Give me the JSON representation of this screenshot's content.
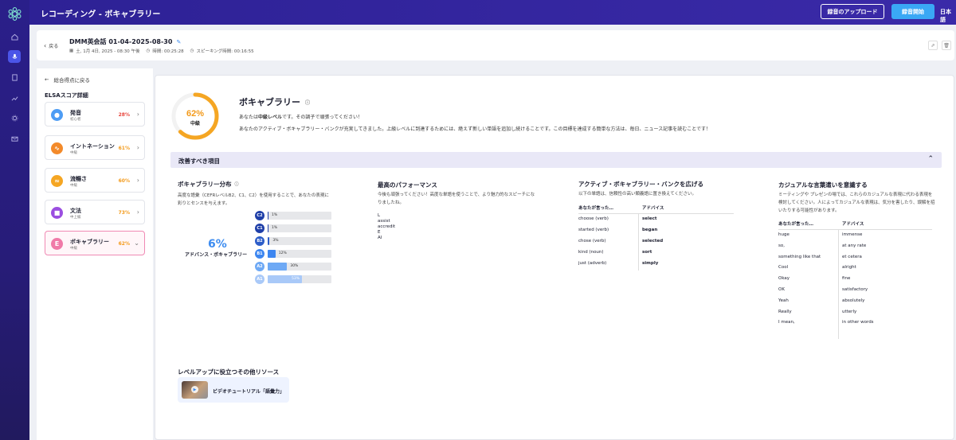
{
  "app": {
    "title": "レコーディング - ボキャブラリー",
    "upload_label": "録音のアップロード",
    "record_label": "録音開始",
    "language": "日本語"
  },
  "recording": {
    "back_label": "戻る",
    "title": "DMM英会話 01-04-2025-08-30",
    "date": "土, 1月 4日, 2025 - 08:30 午後",
    "duration": "時間: 00:25:28",
    "speaking_time": "スピーキング時間: 00:16:55"
  },
  "left": {
    "back_label": "総合得点に戻る",
    "heading": "ELSAスコア詳細",
    "categories": [
      {
        "name": "発音",
        "level": "初心者",
        "percent": "28%",
        "color": "#e8453c",
        "iconColor": "#4d9cf4",
        "icon": "microphone-icon"
      },
      {
        "name": "イントネーション",
        "level": "中級",
        "percent": "61%",
        "color": "#f39a1a",
        "iconColor": "#f38a2a",
        "icon": "intonation-icon"
      },
      {
        "name": "流暢さ",
        "level": "中級",
        "percent": "60%",
        "color": "#f39a1a",
        "iconColor": "#f5a623",
        "icon": "fluency-icon"
      },
      {
        "name": "文法",
        "level": "中上級",
        "percent": "73%",
        "color": "#f39a1a",
        "iconColor": "#9b4ee0",
        "icon": "grammar-icon"
      },
      {
        "name": "ボキャブラリー",
        "level": "中級",
        "percent": "62%",
        "color": "#f39a1a",
        "iconColor": "#f07aa8",
        "icon": "E"
      }
    ]
  },
  "vocab": {
    "score": "62%",
    "score_value": 0.62,
    "level": "中級",
    "title": "ボキャブラリー",
    "desc1_a": "あなたは",
    "desc1_b": "中級レベル",
    "desc1_c": "です。その調子で頑張ってください！",
    "desc2": "あなたのアクティブ・ボキャブラリー・バンクが充実してきました。上級レベルに到達するためには、絶えず新しい単語を追加し続けることです。この目標を達成する簡単な方法は、毎日、ニュース記事を読むことです！",
    "improve_label": "改善すべき項目"
  },
  "distribution": {
    "title": "ボキャブラリー分布",
    "desc": "高度な語彙（CEFRレベルB2、C1、C2）を使用することで、あなたの表現に彩りとセンスを与えます。",
    "advanced_pct": "6%",
    "advanced_label": "アドバンス・ボキャブラリー",
    "levels": [
      {
        "code": "C2",
        "pct": "1%",
        "value": 1,
        "color": "#1f3fa8"
      },
      {
        "code": "C1",
        "pct": "1%",
        "value": 1,
        "color": "#1f3fa8"
      },
      {
        "code": "B2",
        "pct": "3%",
        "value": 3,
        "color": "#2d5dc8"
      },
      {
        "code": "B1",
        "pct": "12%",
        "value": 12,
        "color": "#3d86f0"
      },
      {
        "code": "A2",
        "pct": "30%",
        "value": 30,
        "color": "#6ea9f5"
      },
      {
        "code": "A1",
        "pct": "53%",
        "value": 53,
        "color": "#a9c9f8"
      }
    ]
  },
  "best": {
    "title": "最高のパフォーマンス",
    "desc": "今後も頑張ってください！高度な単語を使うことで、より魅力的なスピーチになりましたね。",
    "words": [
      "L",
      "assist",
      "accredit",
      "E",
      "AI"
    ]
  },
  "active": {
    "title": "アクティブ・ボキャブラリー・バンクを広げる",
    "desc": "以下の単語は、信頼性の高い類義語に置き換えてください。",
    "col1": "あなたが言った…",
    "col2": "アドバイス",
    "rows": [
      [
        "choose (verb)",
        "select"
      ],
      [
        "started (verb)",
        "began"
      ],
      [
        "chose (verb)",
        "selected"
      ],
      [
        "kind (noun)",
        "sort"
      ],
      [
        "just (adverb)",
        "simply"
      ]
    ]
  },
  "casual": {
    "title": "カジュアルな言葉遣いを意識する",
    "desc": "ミーティングや プレゼンの場では、これらのカジュアルな表現に代わる表現を検討してください。人によってカジュアルな表現は、気分を害したり、誤解を招いたりする可能性があります。",
    "col1": "あなたが言った…",
    "col2": "アドバイス",
    "rows": [
      [
        "huge",
        "immense"
      ],
      [
        "so,",
        "at any rate"
      ],
      [
        "something like that",
        "et cetera"
      ],
      [
        "Cool",
        "alright"
      ],
      [
        "Okay",
        "fine"
      ],
      [
        "OK",
        "satisfactory"
      ],
      [
        "Yeah",
        "absolutely"
      ],
      [
        "Really",
        "utterly"
      ],
      [
        "I mean,",
        "in other words"
      ]
    ]
  },
  "resources": {
    "title": "レベルアップに役立つその他リソース",
    "video_label": "ビデオチュートリアル「語彙力」"
  }
}
